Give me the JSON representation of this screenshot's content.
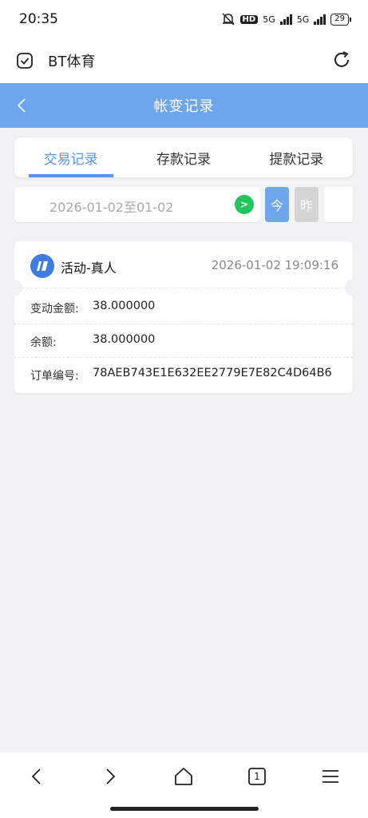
{
  "status_bar": {
    "time": "20:35",
    "network_1": "5G",
    "network_2": "5G",
    "hd_badge": "HD",
    "battery": "29"
  },
  "browser": {
    "site_title": "BT体育"
  },
  "header": {
    "title": "帐变记录"
  },
  "tabs": [
    {
      "label": "交易记录",
      "active": true
    },
    {
      "label": "存款记录",
      "active": false
    },
    {
      "label": "提款记录",
      "active": false
    }
  ],
  "filter": {
    "date_range": "2026-01-02至01-02",
    "go_label": ">",
    "today_label": "今",
    "yesterday_label": "昨"
  },
  "record": {
    "category": "活动-真人",
    "time": "2026-01-02 19:09:16",
    "rows": [
      {
        "label": "变动金额:",
        "value": "38.000000"
      },
      {
        "label": "余额:",
        "value": "38.000000"
      },
      {
        "label": "订单编号:",
        "value": "78AEB743E1E632EE2779E7E82C4D64B6"
      }
    ]
  },
  "bottom_nav": {
    "tab_count": "1"
  },
  "colors": {
    "primary": "#6ea6ee",
    "tab_active": "#5a93e8",
    "go_green": "#22c55e",
    "page_bg": "#f2f2f4"
  }
}
